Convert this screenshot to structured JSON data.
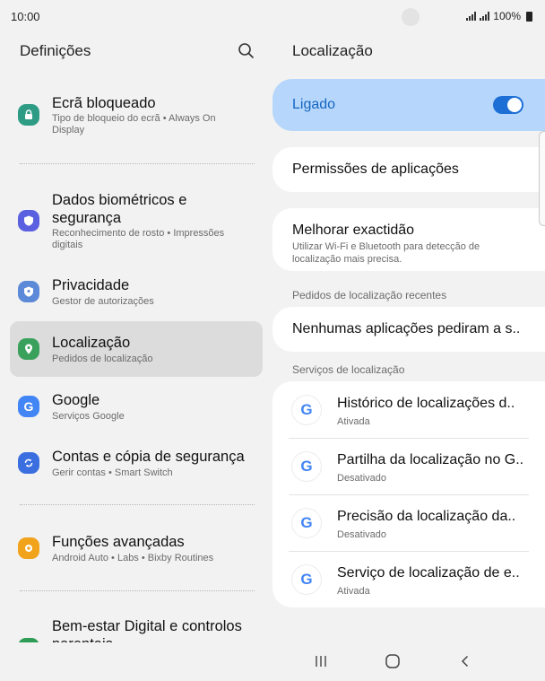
{
  "status_bar": {
    "time": "10:00",
    "battery": "100%"
  },
  "left_panel": {
    "title": "Definições",
    "items": [
      {
        "title": "Ecrã bloqueado",
        "subtitle": "Tipo de bloqueio do ecrã  •  Always On Display",
        "icon": "lock-icon",
        "color": "#2e9c85"
      },
      {
        "title": "Dados biométricos e segurança",
        "subtitle": "Reconhecimento de rosto  •  Impressões digitais",
        "icon": "shield-icon",
        "color": "#5a60e0"
      },
      {
        "title": "Privacidade",
        "subtitle": "Gestor de autorizações",
        "icon": "privacy-icon",
        "color": "#5c89d8"
      },
      {
        "title": "Localização",
        "subtitle": "Pedidos de localização",
        "icon": "location-icon",
        "color": "#3aa15c"
      },
      {
        "title": "Google",
        "subtitle": "Serviços Google",
        "icon": "google-icon",
        "color": "#4285f4"
      },
      {
        "title": "Contas e cópia de segurança",
        "subtitle": "Gerir contas  •  Smart Switch",
        "icon": "sync-icon",
        "color": "#3b6fe0"
      },
      {
        "title": "Funções avançadas",
        "subtitle": "Android Auto  •  Labs  •  Bixby Routines",
        "icon": "gear-plus-icon",
        "color": "#f1a31c"
      },
      {
        "title": "Bem-estar Digital e controlos parentais",
        "subtitle": "",
        "icon": "wellbeing-icon",
        "color": "#2e9c55"
      }
    ]
  },
  "right_panel": {
    "title": "Localização",
    "master_toggle": {
      "label": "Ligado",
      "on": true
    },
    "app_permissions": "Permissões de aplicações",
    "improve_accuracy": {
      "title": "Melhorar exactidão",
      "subtitle": "Utilizar Wi-Fi e Bluetooth para detecção de localização mais precisa."
    },
    "recent_requests_label": "Pedidos de localização recentes",
    "recent_requests_value": "Nenhumas aplicações pediram a s..",
    "services_label": "Serviços de localização",
    "services": [
      {
        "title": "Histórico de localizações d..",
        "status": "Ativada"
      },
      {
        "title": "Partilha da localização no G..",
        "status": "Desativado"
      },
      {
        "title": "Precisão da localização da..",
        "status": "Desativado"
      },
      {
        "title": "Serviço de localização de e..",
        "status": "Ativada"
      }
    ]
  },
  "colors": {
    "accent": "#1d6fd6",
    "master_bg": "#b6d7fb",
    "background": "#f2f2f2"
  }
}
